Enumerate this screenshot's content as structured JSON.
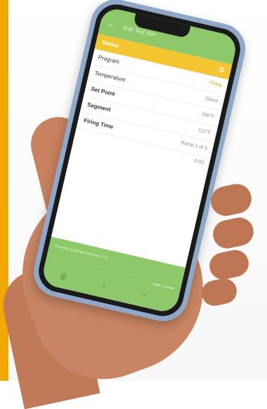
{
  "app": {
    "title": "Edit Test Kiln",
    "back_icon": "arrow-left-icon",
    "settings_icon": "gear-icon",
    "status_title": "Status"
  },
  "details": [
    {
      "label": "Program",
      "value": "Firing"
    },
    {
      "label": "Temperature",
      "value": "Glaze"
    },
    {
      "label": "Set Point",
      "value": "106°F"
    },
    {
      "label": "Segment",
      "value": "112°F"
    },
    {
      "label": "Firing Time",
      "value": "Ramp 1 of 3"
    }
  ],
  "timer": {
    "value": "0:00"
  },
  "footer": {
    "text": "Powered by Bartlett Instrument Co."
  },
  "nav": {
    "right_text": "Legal | Contact",
    "recent_icon": "recent-apps-icon",
    "home_icon": "home-icon",
    "back_icon": "back-icon"
  },
  "colors": {
    "accent_green": "#8dc86a",
    "status_yellow": "#f2c531",
    "brand_orange": "#f0a800"
  }
}
